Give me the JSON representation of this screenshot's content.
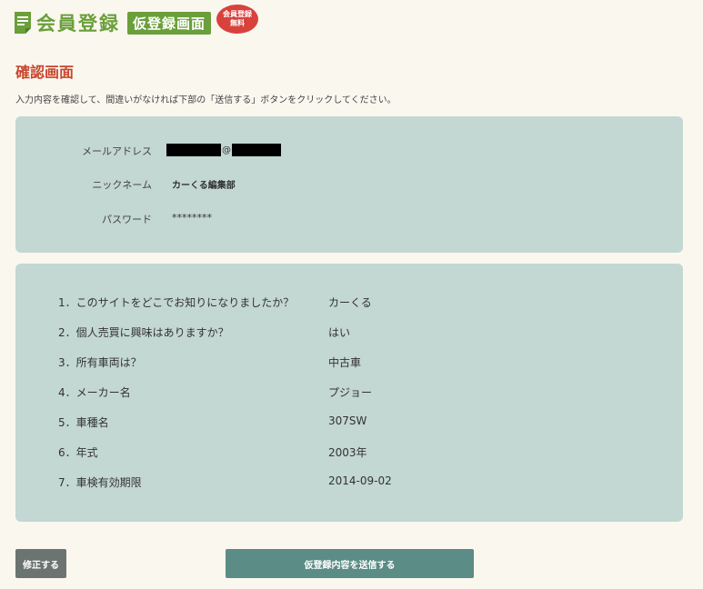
{
  "header": {
    "site_title": "会員登録",
    "badge": "仮登録画面",
    "bubble_line1": "会員登録",
    "bubble_line2": "無料"
  },
  "page": {
    "title": "確認画面",
    "instruction": "入力内容を確認して、間違いがなければ下部の「送信する」ボタンをクリックしてください。"
  },
  "account": [
    {
      "label": "メールアドレス",
      "value": "@"
    },
    {
      "label": "ニックネーム",
      "value": "カーくる編集部"
    },
    {
      "label": "パスワード",
      "value": "********"
    }
  ],
  "survey": [
    {
      "question": "1．このサイトをどこでお知りになりましたか？",
      "answer": "カーくる"
    },
    {
      "question": "2．個人売買に興味はありますか？",
      "answer": "はい"
    },
    {
      "question": "3．所有車両は？",
      "answer": "中古車"
    },
    {
      "question": "4．メーカー名",
      "answer": "プジョー"
    },
    {
      "question": "5．車種名",
      "answer": "307SW"
    },
    {
      "question": "6．年式",
      "answer": "2003年"
    },
    {
      "question": "7．車検有効期限",
      "answer": "2014-09-02"
    }
  ],
  "buttons": {
    "fix": "修正する",
    "submit": "仮登録内容を送信する"
  },
  "colors": {
    "brand_green": "#6a9f3a",
    "title_red": "#c8462d",
    "panel_bg": "#c3d7d3",
    "submit_bg": "#5b8c85",
    "fix_bg": "#6b7470"
  },
  "icons": {
    "logo": "document-icon"
  }
}
